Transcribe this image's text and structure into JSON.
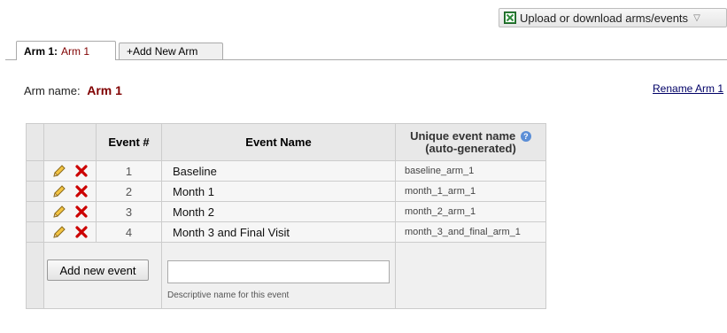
{
  "toolbar": {
    "upload_label": "Upload or download arms/events",
    "upload_icon": "excel-icon",
    "dropdown_icon": "chevron-down-icon"
  },
  "tabs": {
    "active_prefix": "Arm 1:",
    "active_name": "Arm 1",
    "add_label": "+Add New Arm"
  },
  "arm": {
    "name_label": "Arm name:",
    "name_value": "Arm 1",
    "rename_label": "Rename Arm 1"
  },
  "table": {
    "headers": {
      "event_num": "Event #",
      "event_name": "Event Name",
      "unique_line1": "Unique event name",
      "unique_line2": "(auto-generated)"
    },
    "rows": [
      {
        "num": "1",
        "name": "Baseline",
        "unique": "baseline_arm_1"
      },
      {
        "num": "2",
        "name": "Month 1",
        "unique": "month_1_arm_1"
      },
      {
        "num": "3",
        "name": "Month 2",
        "unique": "month_2_arm_1"
      },
      {
        "num": "4",
        "name": "Month 3 and Final Visit",
        "unique": "month_3_and_final_arm_1"
      }
    ],
    "add_button_label": "Add new event",
    "new_event_value": "",
    "new_event_hint": "Descriptive name for this event"
  },
  "colors": {
    "arm_name": "#800000",
    "delete_icon": "#cc0000",
    "help_icon": "#5b8ed6"
  }
}
